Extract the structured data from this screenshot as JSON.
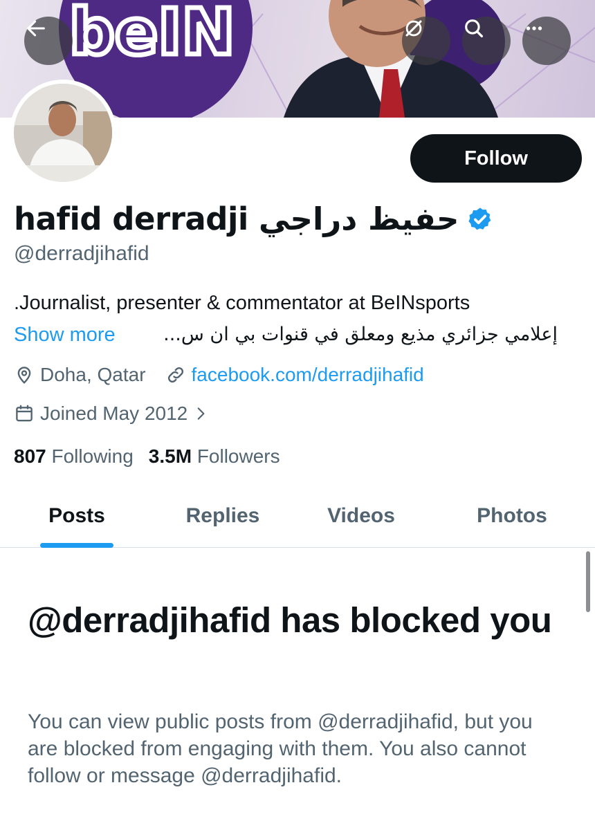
{
  "profile": {
    "display_name": "hafid derradji حفيظ دراجي",
    "handle": "@derradjihafid",
    "bio_line1": ".Journalist, presenter & commentator at BeINsports",
    "bio_line2_arabic": "إعلامي جزائري مذيع ومعلق في قنوات بي ان س...",
    "show_more_label": "Show more",
    "location": "Doha, Qatar",
    "website": "facebook.com/derradjihafid",
    "joined": "Joined May 2012",
    "following_count": "807",
    "following_label": "Following",
    "followers_count": "3.5M",
    "followers_label": "Followers"
  },
  "actions": {
    "follow_label": "Follow"
  },
  "tabs": [
    {
      "label": "Posts",
      "active": true
    },
    {
      "label": "Replies",
      "active": false
    },
    {
      "label": "Videos",
      "active": false
    },
    {
      "label": "Photos",
      "active": false
    }
  ],
  "blocked": {
    "title": "@derradjihafid has blocked you",
    "body": "You can view public posts from @derradjihafid, but you are blocked from engaging with them. You also cannot follow or message @derradjihafid."
  },
  "icons": {
    "back": "arrow-left-icon",
    "grok": "grok-icon",
    "search": "search-icon",
    "more": "more-horizontal-icon",
    "verified": "verified-badge-icon",
    "location": "location-pin-icon",
    "link": "link-icon",
    "calendar": "calendar-icon",
    "chevron": "chevron-right-icon"
  },
  "colors": {
    "accent": "#1d9bf0",
    "text_primary": "#0f1419",
    "text_secondary": "#536471",
    "button_dark": "#0f1419"
  }
}
